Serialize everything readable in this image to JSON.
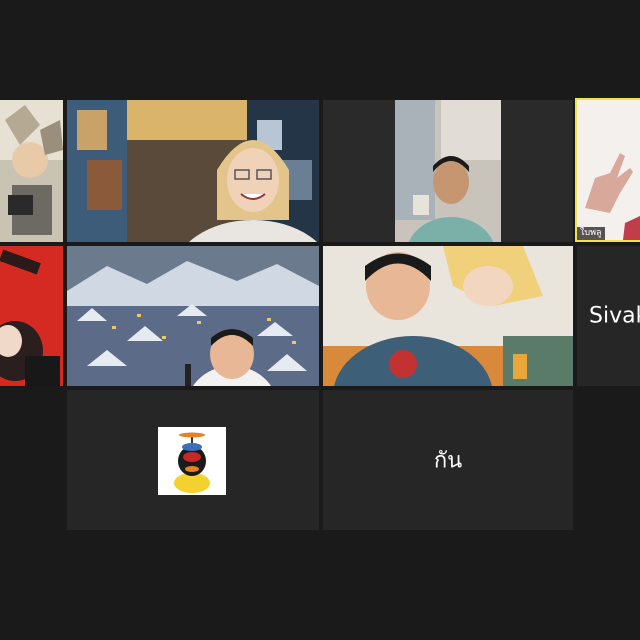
{
  "gallery": {
    "participants": [
      {
        "id": "p1",
        "name": "",
        "video": "anime-character-art",
        "state": "video"
      },
      {
        "id": "p2",
        "name": "",
        "video": "woman-smiling-collage-background",
        "state": "video"
      },
      {
        "id": "p3",
        "name": "",
        "video": "boy-in-room",
        "state": "video"
      },
      {
        "id": "p4",
        "name": "ใบพลู",
        "video": "hand-gesture",
        "state": "video",
        "active_speaker": true
      },
      {
        "id": "p5",
        "name": "",
        "video": "red-poster-art",
        "state": "video"
      },
      {
        "id": "p6",
        "name": "",
        "video": "boy-snowy-village-background",
        "state": "video"
      },
      {
        "id": "p7",
        "name": "",
        "video": "boy-anime-background",
        "state": "video"
      },
      {
        "id": "p8",
        "name": "Sivak",
        "state": "camera-off"
      },
      {
        "id": "p9",
        "name": "",
        "avatar": "duck-with-propeller-helmet",
        "state": "camera-off"
      },
      {
        "id": "p10",
        "name": "กัน",
        "state": "camera-off"
      }
    ]
  },
  "colors": {
    "background": "#1a1a1a",
    "tile_off": "#262626",
    "active_speaker_border": "#f2e24a"
  }
}
